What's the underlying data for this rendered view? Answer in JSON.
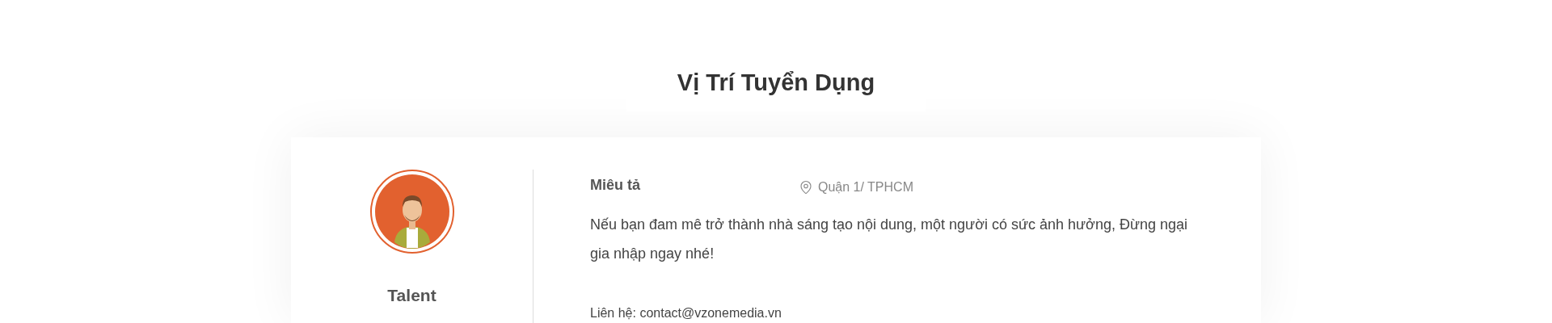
{
  "heading": "Vị Trí Tuyển Dụng",
  "job": {
    "title": "Talent",
    "description_label": "Miêu tả",
    "location": "Quận 1/ TPHCM",
    "description": "Nếu bạn đam mê trở thành nhà sáng tạo nội dung, một người có sức ảnh hưởng, Đừng ngại gia nhập ngay nhé!",
    "contact": "Liên hệ: contact@vzonemedia.vn"
  }
}
